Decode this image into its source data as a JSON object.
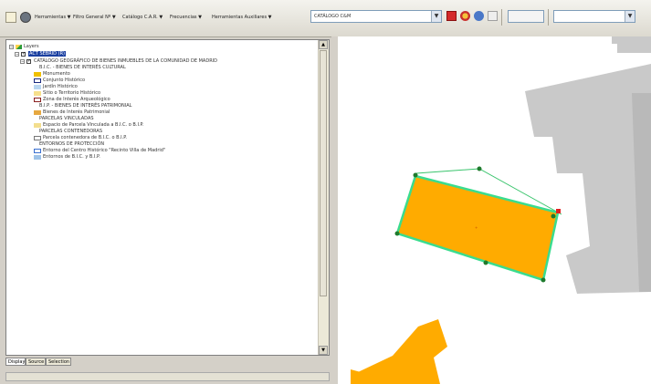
{
  "toolbar": {
    "menu_items": [
      "Herramientas ▼",
      "Filtro General Nº ▼",
      "Catálogo C.A.R. ▼",
      "Frecuencias ▼",
      "Herramientas Auxiliares ▼"
    ],
    "layer_combo": "CATÁLOGO C&M",
    "search_combo": ""
  },
  "layers": {
    "root": "Layers",
    "selected": "ACT SEBRID (R)",
    "catalog": "CATÁLOGO GEOGRÁFICO DE BIENES INMUEBLES DE LA COMUNIDAD DE MADRID",
    "items": [
      {
        "label": "B.I.C. - BIENES DE INTERÉS CULTURAL",
        "swatch": ""
      },
      {
        "label": "Monumento",
        "swatch": "#f0c000"
      },
      {
        "label": "Conjunto Histórico",
        "swatch": "outline-navy"
      },
      {
        "label": "Jardín Histórico",
        "swatch": "#b9d6f0"
      },
      {
        "label": "Sitio o Territorio Histórico",
        "swatch": "#f6e08c"
      },
      {
        "label": "Zona de Interés Arqueológico",
        "swatch": "outline-brown"
      },
      {
        "label": "B.I.P. - BIENES DE INTERÉS PATRIMONIAL",
        "swatch": ""
      },
      {
        "label": "Bienes de Interés Patrimonial",
        "swatch": "#e6a840"
      },
      {
        "label": "PARCELAS VINCULADAS",
        "swatch": ""
      },
      {
        "label": "Espacio de Parcela Vinculada a B.I.C. o B.I.P.",
        "swatch": "#f3de8e"
      },
      {
        "label": "PARCELAS CONTENEDORAS",
        "swatch": ""
      },
      {
        "label": "Parcela contenedora de B.I.C. o B.I.P.",
        "swatch": "outline-gray"
      },
      {
        "label": "ENTORNOS DE PROTECCIÓN",
        "swatch": ""
      },
      {
        "label": "Entorno del Centro Histórico \"Recinto Villa de Madrid\"",
        "swatch": "outline-blue"
      },
      {
        "label": "Entornos de B.I.C. y B.I.P.",
        "swatch": "#9fc3e8"
      }
    ]
  },
  "tabs": [
    "Display",
    "Source",
    "Selection"
  ],
  "colors": {
    "parcel_fill": "#ffab00",
    "parcel_outline": "#3adc8e",
    "building_gray": "#c9c9c9",
    "vertex": "#1f7a2d",
    "vertex_selected": "#e02020"
  }
}
